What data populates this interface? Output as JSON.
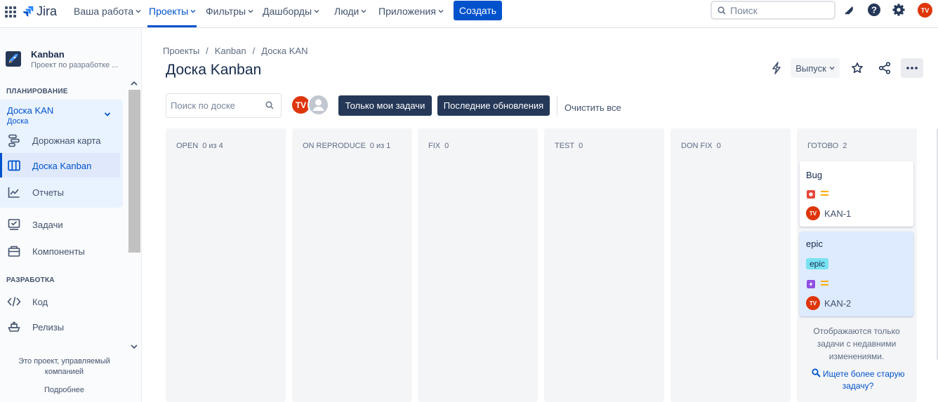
{
  "topnav": {
    "logo": "Jira",
    "items": [
      {
        "label": "Ваша работа"
      },
      {
        "label": "Проекты"
      },
      {
        "label": "Фильтры"
      },
      {
        "label": "Дашборды"
      },
      {
        "label": "Люди"
      },
      {
        "label": "Приложения"
      }
    ],
    "create_label": "Создать",
    "search_placeholder": "Поиск",
    "user_initials": "TV",
    "accent": "#0052cc",
    "avatar_color": "#de350b"
  },
  "sidebar": {
    "project_name": "Kanban",
    "project_sub": "Проект по разработке ...",
    "planning_header": "ПЛАНИРОВАНИЕ",
    "board_title": "Доска KAN",
    "board_sub": "Доска",
    "items": [
      {
        "label": "Дорожная карта",
        "icon": "roadmap-icon"
      },
      {
        "label": "Доска Kanban",
        "icon": "board-icon"
      },
      {
        "label": "Отчеты",
        "icon": "reports-icon"
      },
      {
        "label": "Задачи",
        "icon": "issues-icon"
      },
      {
        "label": "Компоненты",
        "icon": "components-icon"
      }
    ],
    "dev_header": "РАЗРАБОТКА",
    "dev_items": [
      {
        "label": "Код",
        "icon": "code-icon"
      },
      {
        "label": "Релизы",
        "icon": "releases-icon"
      }
    ],
    "footer_text": "Это проект, управляемый компанией",
    "footer_link": "Подробнее"
  },
  "main": {
    "breadcrumbs": [
      "Проекты",
      "/",
      "Kanban",
      "/",
      "Доска KAN"
    ],
    "title": "Доска Kanban",
    "release_label": "Выпуск",
    "search_placeholder": "Поиск по доске",
    "filter_mine": "Только мои задачи",
    "filter_recent": "Последние обновления",
    "clear_all": "Очистить все",
    "columns": [
      {
        "name": "OPEN",
        "count": "0 из 4"
      },
      {
        "name": "ON REPRODUCE",
        "count": "0 из 1"
      },
      {
        "name": "FIX",
        "count": "0"
      },
      {
        "name": "TEST",
        "count": "0"
      },
      {
        "name": "DON FIX",
        "count": "0"
      },
      {
        "name": "ГОТОВО",
        "count": "2"
      }
    ],
    "cards": [
      {
        "title": "Bug",
        "key": "KAN-1",
        "type": "bug-icon",
        "priority": "medium-priority-icon",
        "assignee": "TV"
      },
      {
        "title": "epic",
        "label": "epic",
        "key": "KAN-2",
        "type": "epic-icon",
        "priority": "medium-priority-icon",
        "assignee": "TV"
      }
    ],
    "done_note": "Отображаются только задачи с недавними изменениями.",
    "done_link": "Ищете более старую задачу?"
  }
}
